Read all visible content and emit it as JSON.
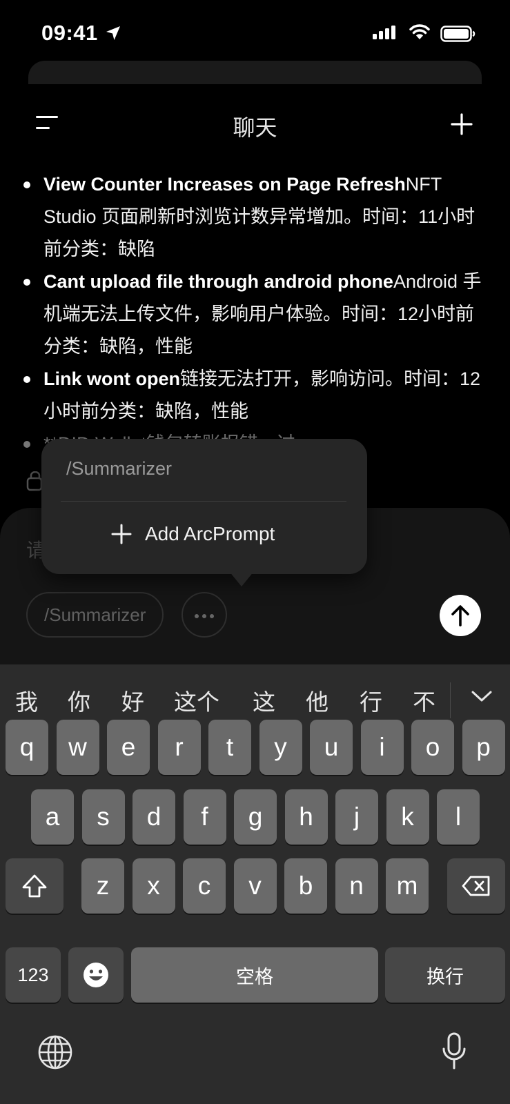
{
  "status": {
    "time": "09:41"
  },
  "header": {
    "title": "聊天"
  },
  "messages": [
    {
      "bold": "View Counter Increases on Page Refresh",
      "text": "NFT Studio 页面刷新时浏览计数异常增加。时间：11小时前分类：缺陷"
    },
    {
      "bold": "Cant upload file through android phone",
      "text": "Android 手机端无法上传文件，影响用户体验。时间：12小时前分类：缺陷，性能"
    },
    {
      "bold": "Link wont open",
      "text": "链接无法打开，影响访问。时间：12小时前分类：缺陷，性能"
    },
    {
      "bold": "",
      "text": "**DID Wallet钱包转账报错，过"
    }
  ],
  "composer": {
    "placeholder": "请",
    "chip": "/Summarizer"
  },
  "popover": {
    "item": "/Summarizer",
    "add_label": "Add ArcPrompt"
  },
  "keyboard": {
    "candidates": [
      "我",
      "你",
      "好",
      "这个",
      "这",
      "他",
      "行",
      "不"
    ],
    "row1": [
      "q",
      "w",
      "e",
      "r",
      "t",
      "y",
      "u",
      "i",
      "o",
      "p"
    ],
    "row2": [
      "a",
      "s",
      "d",
      "f",
      "g",
      "h",
      "j",
      "k",
      "l"
    ],
    "row3": [
      "z",
      "x",
      "c",
      "v",
      "b",
      "n",
      "m"
    ],
    "numbers_label": "123",
    "space_label": "空格",
    "return_label": "换行"
  }
}
